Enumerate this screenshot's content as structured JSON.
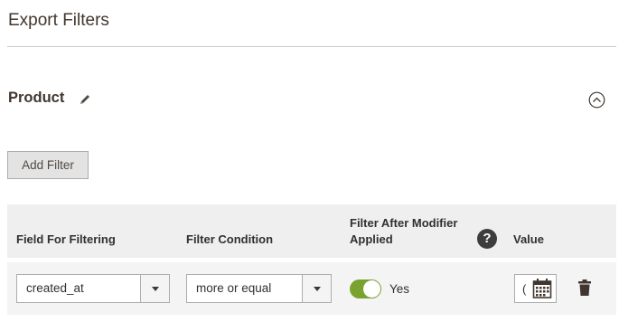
{
  "header": {
    "title": "Export Filters"
  },
  "section": {
    "title": "Product",
    "edit_icon": "pencil-icon",
    "collapse_icon": "chevron-up-circle-icon"
  },
  "toolbar": {
    "add_filter_label": "Add Filter"
  },
  "grid": {
    "columns": {
      "field": "Field For Filtering",
      "condition": "Filter Condition",
      "after_modifier": "Filter After Modifier Applied",
      "help_glyph": "?",
      "value": "Value"
    },
    "rows": [
      {
        "field": "created_at",
        "condition": "more or equal",
        "after_modifier_on": true,
        "after_modifier_label": "Yes",
        "value": "(",
        "value_icon": "calendar-icon",
        "delete_icon": "trash-icon"
      }
    ]
  },
  "colors": {
    "toggle_on": "#79a22e",
    "header_bg": "#efefef",
    "row_bg": "#f4f4f4",
    "button_bg": "#e3e3e3"
  }
}
